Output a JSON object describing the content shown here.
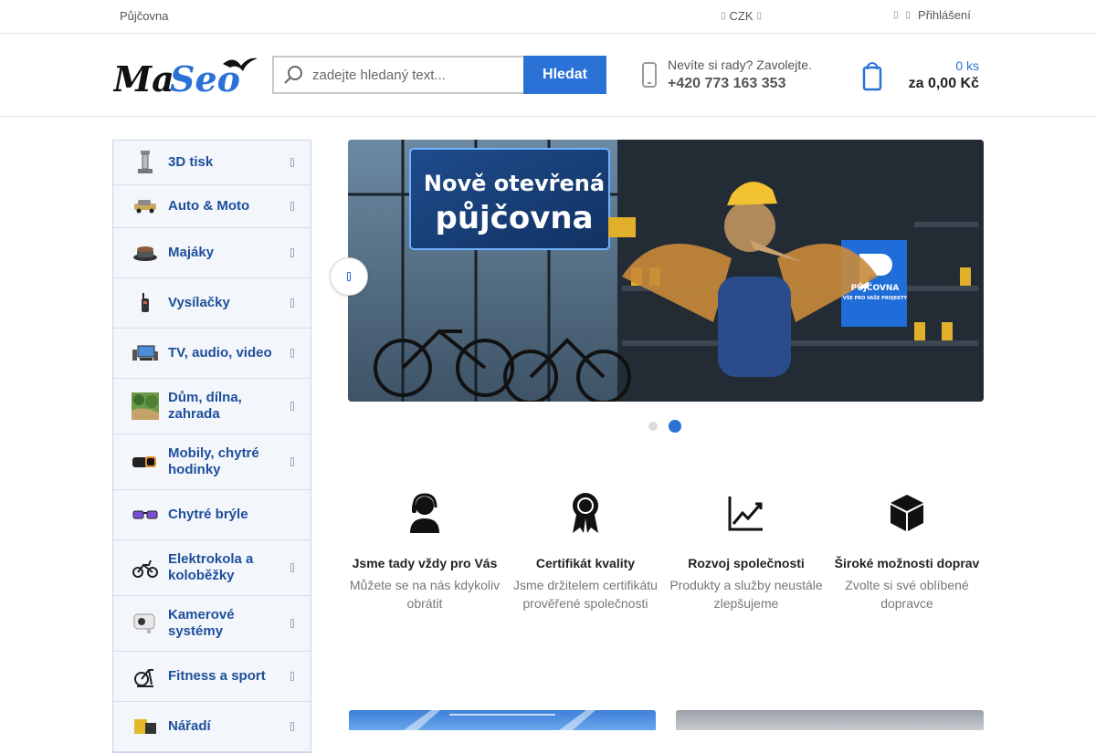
{
  "topbar": {
    "left_link": "Půjčovna",
    "currency": "CZK",
    "login": "Přihlášení"
  },
  "header": {
    "logo_text": "MaSeo",
    "search": {
      "placeholder": "zadejte hledaný text...",
      "button": "Hledat"
    },
    "phone": {
      "text": "Nevíte si rady? Zavolejte.",
      "number": "+420 773 163 353"
    },
    "cart": {
      "qty": "0 ks",
      "sum": "za 0,00 Kč"
    }
  },
  "sidebar": {
    "items": [
      {
        "label": "3D tisk",
        "icon": "3d-printer-icon"
      },
      {
        "label": "Auto & Moto",
        "icon": "car-icon"
      },
      {
        "label": "Majáky",
        "icon": "beacon-icon"
      },
      {
        "label": "Vysílačky",
        "icon": "walkie-talkie-icon"
      },
      {
        "label": "TV, audio, video",
        "icon": "tv-icon"
      },
      {
        "label": "Dům, dílna, zahrada",
        "icon": "garden-icon"
      },
      {
        "label": "Mobily, chytré hodinky",
        "icon": "phone-icon"
      },
      {
        "label": "Chytré brýle",
        "icon": "glasses-icon"
      },
      {
        "label": "Elektrokola a koloběžky",
        "icon": "ebike-icon"
      },
      {
        "label": "Kamerové systémy",
        "icon": "camera-icon"
      },
      {
        "label": "Fitness a sport",
        "icon": "fitness-icon"
      },
      {
        "label": "Nářadí",
        "icon": "tools-icon"
      }
    ]
  },
  "banner": {
    "headline_1": "Nově otevřená",
    "headline_2": "půjčovna",
    "sign_text": "PŮJČOVNA",
    "sign_sub": "VŠE PRO VAŠE PROJEKTY",
    "active_slide": 2,
    "slide_count": 2
  },
  "features": [
    {
      "title": "Jsme tady vždy pro Vás",
      "desc": "Můžete se na nás kdykoliv obrátit",
      "icon": "support-agent-icon"
    },
    {
      "title": "Certifikát kvality",
      "desc": "Jsme držitelem certifikátu prověřené společnosti",
      "icon": "award-ribbon-icon"
    },
    {
      "title": "Rozvoj společnosti",
      "desc": "Produkty a služby neustále zlepšujeme",
      "icon": "growth-chart-icon"
    },
    {
      "title": "Široké možnosti doprav",
      "desc": "Zvolte si své oblíbené dopravce",
      "icon": "package-box-icon"
    }
  ],
  "colors": {
    "accent": "#2a72d6",
    "category_text": "#1d4f9c",
    "sidebar_bg": "#f3f6fa"
  }
}
